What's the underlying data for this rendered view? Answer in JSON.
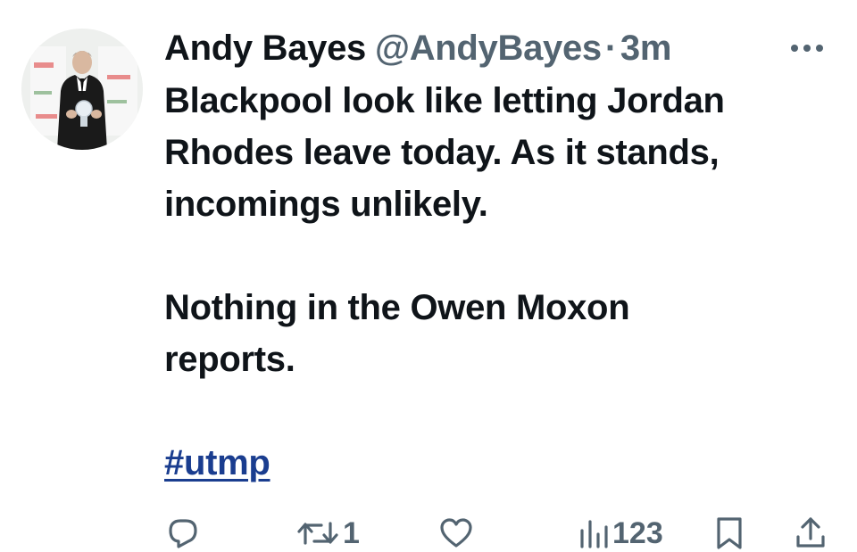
{
  "tweet": {
    "display_name": "Andy Bayes",
    "handle": "@AndyBayes",
    "separator": "·",
    "time": "3m",
    "lines": [
      "Blackpool look like letting Jordan",
      "Rhodes leave today.  As it stands,",
      "incomings unlikely.",
      "Nothing in the Owen Moxon",
      "reports."
    ],
    "hashtag": "#utmp"
  },
  "actions": {
    "reply": {
      "icon": "reply-icon",
      "count": ""
    },
    "retweet": {
      "icon": "retweet-icon",
      "count": "1"
    },
    "like": {
      "icon": "heart-icon",
      "count": ""
    },
    "views": {
      "icon": "views-icon",
      "count": "123"
    },
    "bookmark": {
      "icon": "bookmark-icon"
    },
    "share": {
      "icon": "share-icon"
    }
  },
  "colors": {
    "text": "#0f1419",
    "secondary": "#536471",
    "hashtag": "#1a3d8f"
  }
}
